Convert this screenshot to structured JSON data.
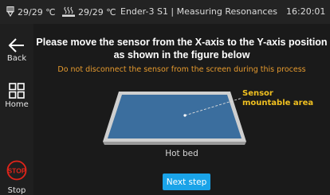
{
  "status_bar": {
    "nozzle_temp": "29/29 ℃",
    "bed_temp": "29/29 ℃",
    "title": "Ender-3 S1 | Measuring Resonances",
    "time": "16:20:01"
  },
  "sidebar": {
    "back_label": "Back",
    "home_label": "Home",
    "stop_label": "Stop",
    "stop_icon_text": "STOP"
  },
  "main": {
    "instruction": "Please move the sensor from the X-axis to the Y-axis position as shown in the figure below",
    "warning": "Do not disconnect the sensor from the screen during this process",
    "area_label": "Sensor mountable area",
    "hotbed_label": "Hot bed",
    "next_button": "Next step"
  },
  "colors": {
    "warning": "#e69a2e",
    "area_label": "#f0c020",
    "accent_button": "#1aa3e8",
    "bed_fill": "#3b6e9e",
    "stop_red": "#e0241a"
  }
}
